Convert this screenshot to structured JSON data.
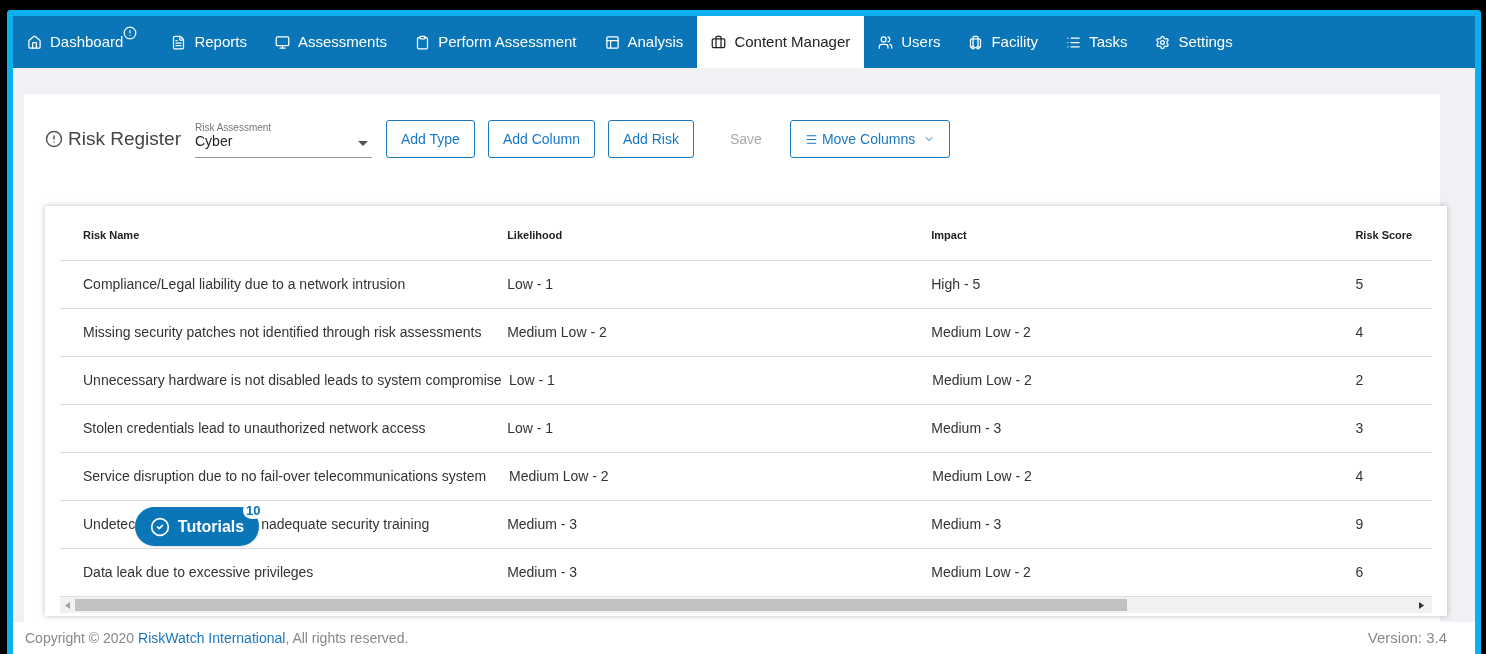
{
  "nav": {
    "tabs": [
      {
        "label": "Dashboard",
        "alert": true,
        "selected": false
      },
      {
        "label": "Reports",
        "alert": false,
        "selected": false
      },
      {
        "label": "Assessments",
        "alert": false,
        "selected": false
      },
      {
        "label": "Perform Assessment",
        "alert": false,
        "selected": false
      },
      {
        "label": "Analysis",
        "alert": false,
        "selected": false
      },
      {
        "label": "Content Manager",
        "alert": false,
        "selected": true
      },
      {
        "label": "Users",
        "alert": false,
        "selected": false
      },
      {
        "label": "Facility",
        "alert": false,
        "selected": false
      },
      {
        "label": "Tasks",
        "alert": false,
        "selected": false
      },
      {
        "label": "Settings",
        "alert": false,
        "selected": false
      }
    ]
  },
  "toolbar": {
    "title": "Risk Register",
    "select": {
      "label": "Risk Assessment",
      "value": "Cyber"
    },
    "buttons": [
      {
        "label": "Add Type",
        "disabled": false,
        "dropdown": false
      },
      {
        "label": "Add Column",
        "disabled": false,
        "dropdown": false
      },
      {
        "label": "Add Risk",
        "disabled": false,
        "dropdown": false
      },
      {
        "label": "Save",
        "disabled": true,
        "dropdown": false
      },
      {
        "label": "Move Columns",
        "disabled": false,
        "dropdown": true
      }
    ]
  },
  "table": {
    "columns": [
      "Risk Name",
      "Likelihood",
      "Impact",
      "Risk Score"
    ],
    "rows": [
      [
        [
          "Compliance/Legal liability due to a network intrusion"
        ],
        [
          "Low - 1"
        ],
        [
          "High - 5"
        ],
        [
          "5"
        ]
      ],
      [
        [
          "Missing security patches not identified through risk assessments"
        ],
        [
          "Medium Low - 2"
        ],
        [
          "Medium Low - 2"
        ],
        [
          "4"
        ]
      ],
      [
        [
          "Unnecessary hardware is not disabled leads to system compromise"
        ],
        [
          "Low - 1"
        ],
        [
          "Medium Low - 2"
        ],
        [
          "2"
        ]
      ],
      [
        [
          "Stolen credentials lead to unauthorized network access"
        ],
        [
          "Low - 1"
        ],
        [
          "Medium - 3"
        ],
        [
          "3"
        ]
      ],
      [
        [
          "Service disruption due to no fail-over telecommunications system"
        ],
        [
          "Medium Low - 2"
        ],
        [
          "Medium Low - 2"
        ],
        [
          "4"
        ]
      ],
      [
        [
          "Undetec",
          "nadequate security training"
        ],
        [
          "Medium - 3"
        ],
        [
          "Medium - 3"
        ],
        [
          "9"
        ]
      ],
      [
        [
          "Data leak due to excessive privileges"
        ],
        [
          "Medium - 3"
        ],
        [
          "Medium Low - 2"
        ],
        [
          "6"
        ]
      ]
    ]
  },
  "tutorials": {
    "label": "Tutorials",
    "count": "10"
  },
  "footer": {
    "prefix": "Copyright © 2020 ",
    "link": "RiskWatch International",
    "suffix": ", All rights reserved.",
    "version": "Version: 3.4"
  }
}
